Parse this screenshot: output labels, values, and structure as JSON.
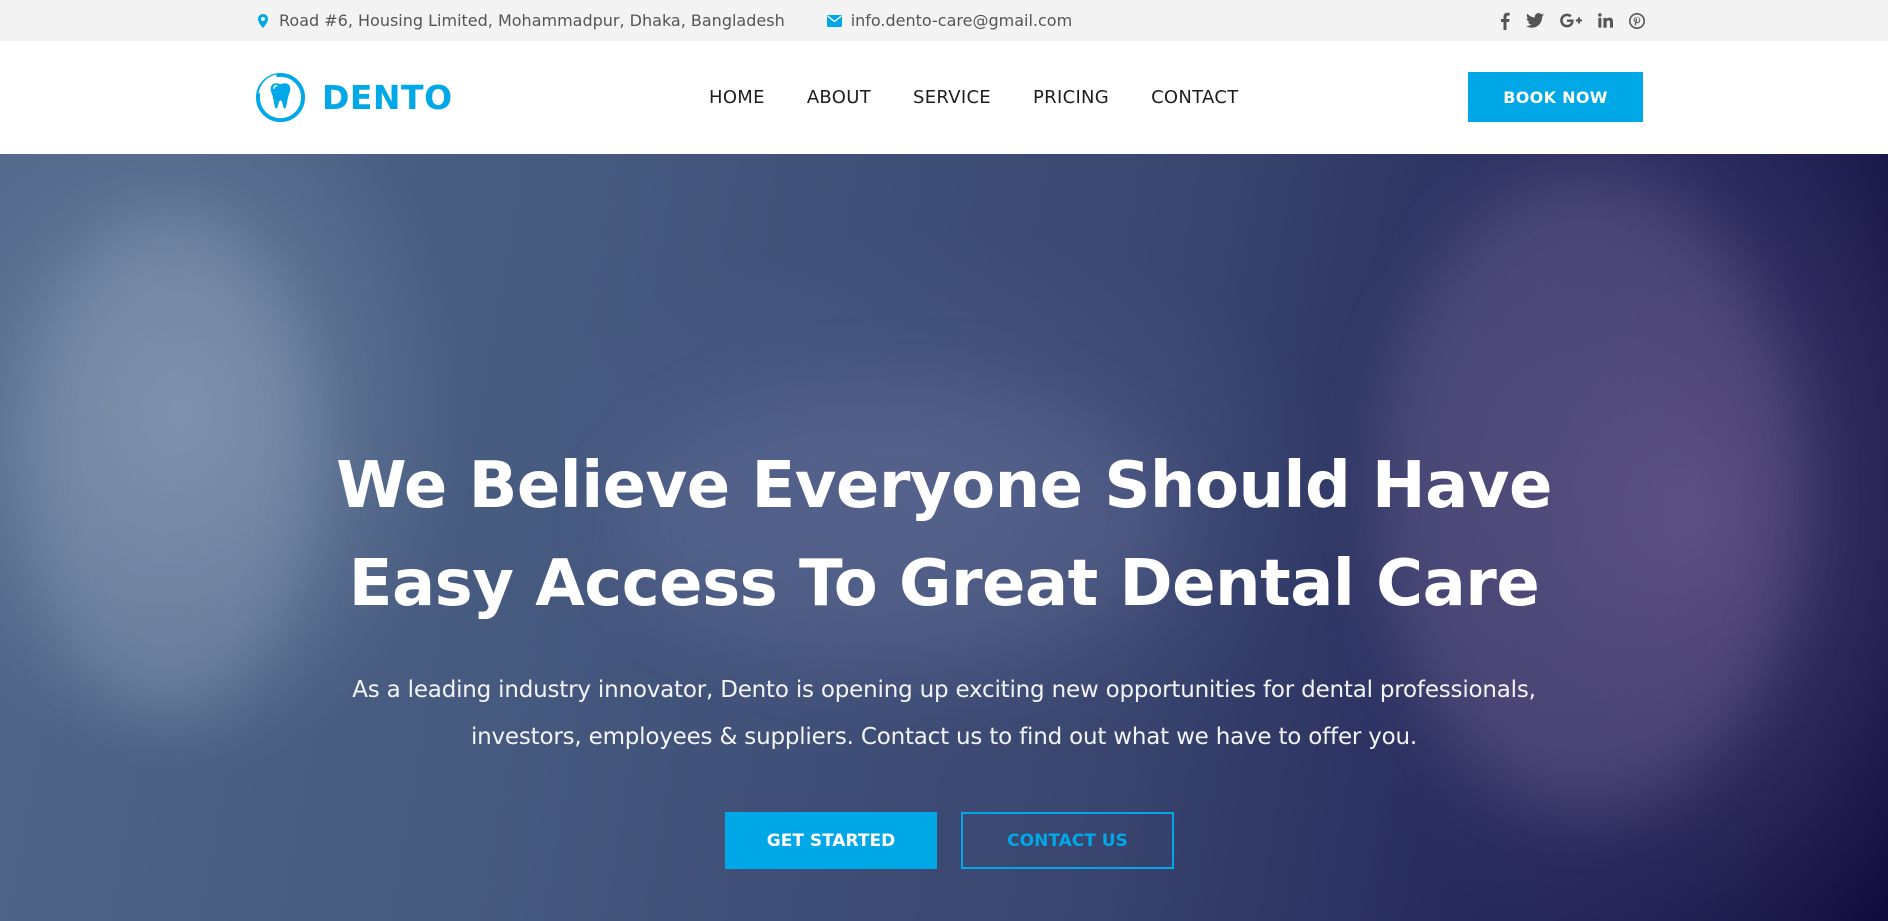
{
  "topbar": {
    "address": "Road #6, Housing Limited, Mohammadpur, Dhaka, Bangladesh",
    "email": "info.dento-care@gmail.com",
    "socials": [
      {
        "icon": "facebook-icon",
        "glyph": "f"
      },
      {
        "icon": "twitter-icon",
        "glyph": "🐦"
      },
      {
        "icon": "google-plus-icon",
        "glyph": "G+"
      },
      {
        "icon": "linkedin-icon",
        "glyph": "in"
      },
      {
        "icon": "pinterest-icon",
        "glyph": "℗"
      }
    ]
  },
  "header": {
    "logo_text": "DENTO",
    "nav": [
      "HOME",
      "ABOUT",
      "SERVICE",
      "PRICING",
      "CONTACT"
    ],
    "book_label": "BOOK NOW"
  },
  "hero": {
    "title_line1": "We Believe Everyone Should Have",
    "title_line2": "Easy Access To Great Dental Care",
    "desc_line1": "As a leading industry innovator, Dento is opening up exciting new opportunities for dental professionals,",
    "desc_line2": "investors, employees & suppliers. Contact us to find out what we have to offer you.",
    "primary_label": "GET STARTED",
    "secondary_label": "CONTACT US"
  },
  "colors": {
    "accent": "#00a8e8",
    "topbar_bg": "#f3f3f3",
    "text_dark": "#1d1d1d"
  }
}
